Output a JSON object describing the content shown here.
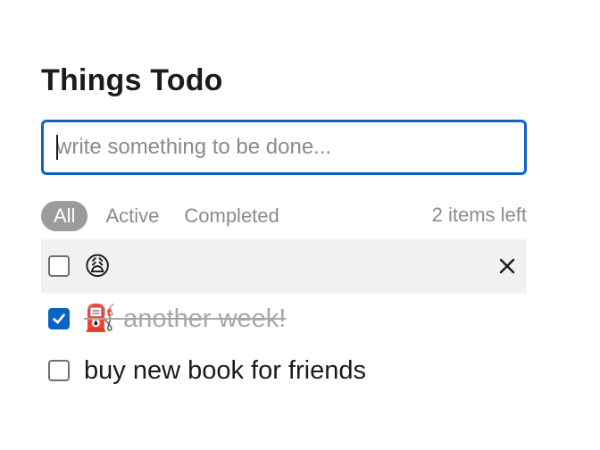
{
  "header": {
    "title": "Things Todo"
  },
  "new_todo": {
    "placeholder": "write something to be done...",
    "value": ""
  },
  "filters": {
    "items": [
      {
        "label": "All",
        "selected": true
      },
      {
        "label": "Active",
        "selected": false
      },
      {
        "label": "Completed",
        "selected": false
      }
    ],
    "count": "2 items left"
  },
  "todos": [
    {
      "text": "😩",
      "completed": false
    },
    {
      "text": "⛽ another week!",
      "completed": true
    },
    {
      "text": "buy new book for friends",
      "completed": false
    }
  ],
  "colors": {
    "accent": "#0b63c4",
    "selected_filter_bg": "#9b9b9b",
    "muted_text": "#8b8b8b",
    "hover_row_bg": "#f1f1f1"
  },
  "icons": {
    "destroy": "close-icon",
    "check": "checkmark-icon"
  }
}
